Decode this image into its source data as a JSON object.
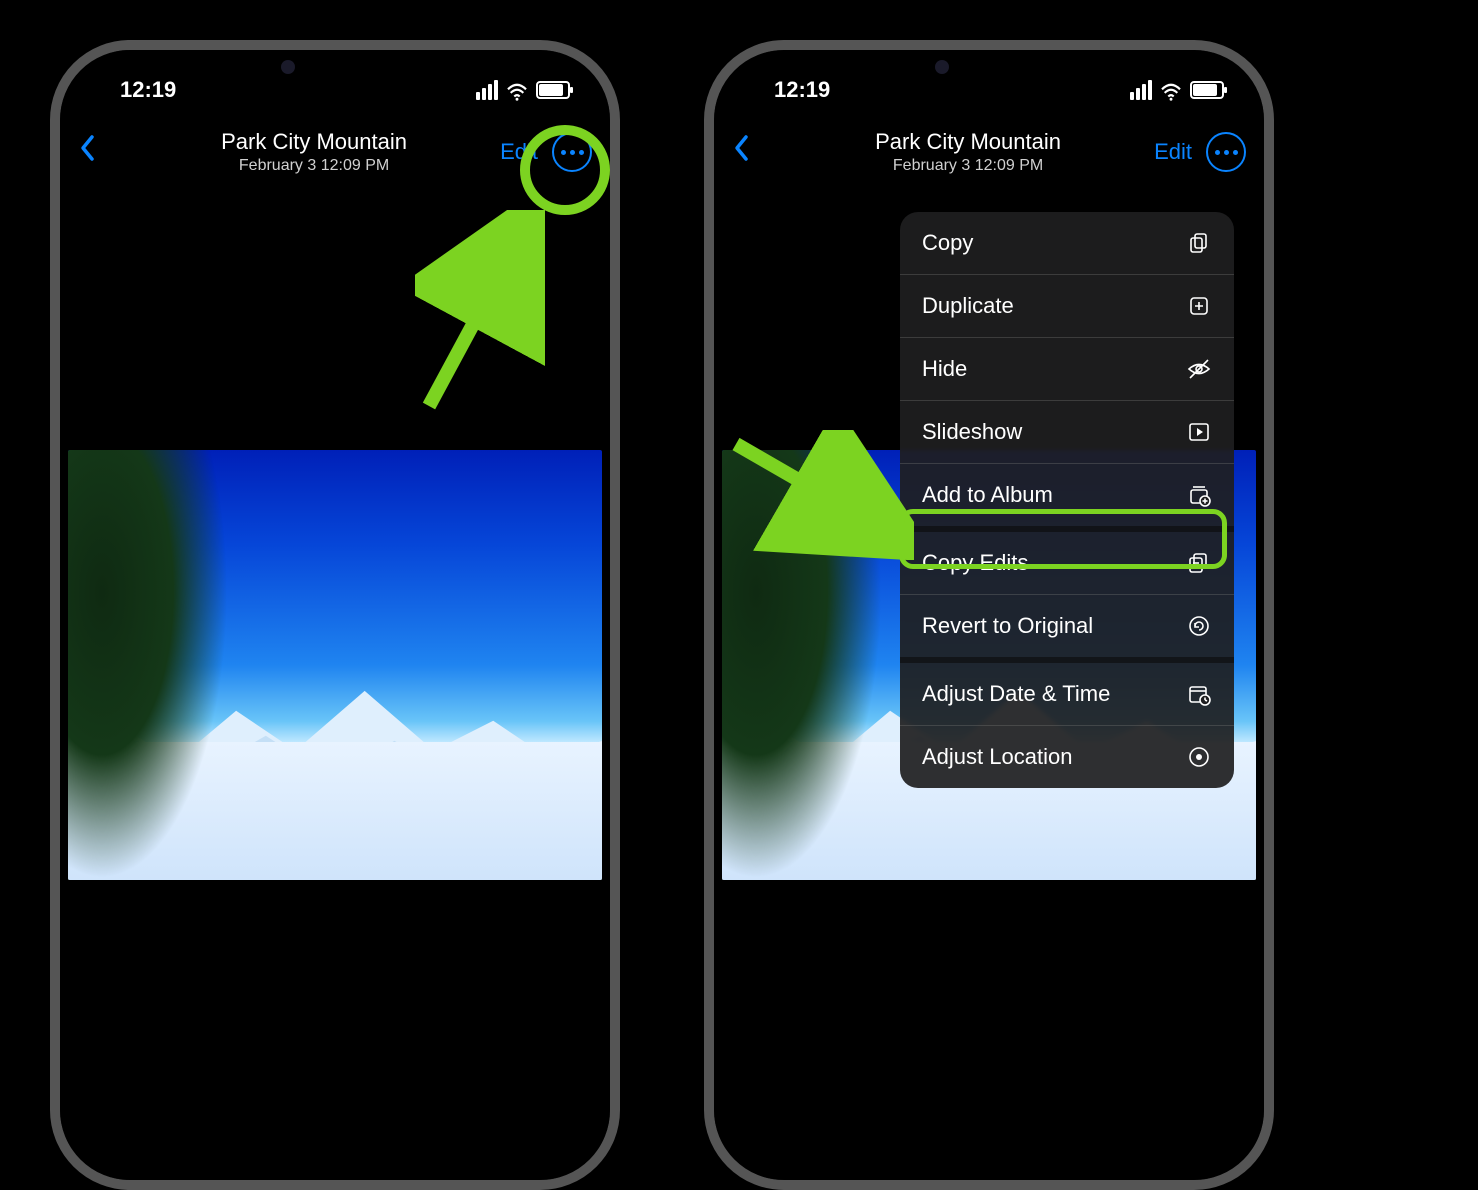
{
  "status": {
    "time": "12:19"
  },
  "header": {
    "title": "Park City Mountain",
    "subtitle": "February 3  12:09 PM",
    "edit_label": "Edit"
  },
  "menu": {
    "items": [
      {
        "label": "Copy",
        "icon": "copy-pages-icon"
      },
      {
        "label": "Duplicate",
        "icon": "duplicate-plus-icon"
      },
      {
        "label": "Hide",
        "icon": "hide-eye-icon"
      },
      {
        "label": "Slideshow",
        "icon": "play-box-icon"
      },
      {
        "label": "Add to Album",
        "icon": "album-add-icon"
      },
      {
        "label": "Copy Edits",
        "icon": "copy-edits-icon"
      },
      {
        "label": "Revert to Original",
        "icon": "revert-icon"
      },
      {
        "label": "Adjust Date & Time",
        "icon": "calendar-clock-icon"
      },
      {
        "label": "Adjust Location",
        "icon": "location-pin-icon"
      }
    ]
  }
}
